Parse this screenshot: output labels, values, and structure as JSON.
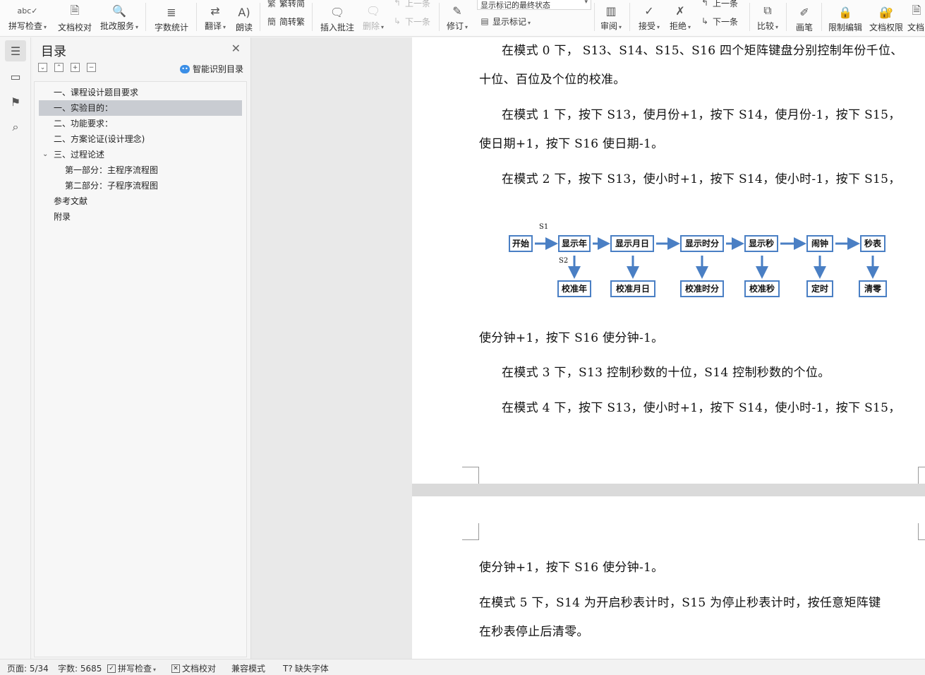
{
  "ribbon": {
    "buttons": [
      {
        "label": "拼写检查",
        "icon": "abc",
        "dropdown": true
      },
      {
        "label": "文档校对",
        "icon": "doc-check",
        "dropdown": false
      },
      {
        "label": "批改服务",
        "icon": "review-service",
        "dropdown": true
      },
      {
        "label": "字数统计",
        "icon": "word-count",
        "dropdown": false
      },
      {
        "label": "翻译",
        "icon": "translate",
        "dropdown": true
      },
      {
        "label": "朗读",
        "icon": "read-aloud",
        "dropdown": false
      },
      {
        "label": "插入批注",
        "icon": "insert-comment",
        "dropdown": false
      },
      {
        "label": "修订",
        "icon": "track-changes",
        "dropdown": true
      },
      {
        "label": "审阅",
        "icon": "review-pane",
        "dropdown": true
      },
      {
        "label": "接受",
        "icon": "accept",
        "dropdown": true
      },
      {
        "label": "拒绝",
        "icon": "reject",
        "dropdown": true
      },
      {
        "label": "比较",
        "icon": "compare",
        "dropdown": true
      },
      {
        "label": "画笔",
        "icon": "pen",
        "dropdown": false
      },
      {
        "label": "限制编辑",
        "icon": "restrict-edit",
        "dropdown": false
      },
      {
        "label": "文档权限",
        "icon": "doc-permission",
        "dropdown": false
      },
      {
        "label": "文档",
        "icon": "doc",
        "dropdown": false
      }
    ],
    "small": {
      "trad_to_simp": "繁转简",
      "simp_to_trad": "简转繁",
      "delete": "删除",
      "prev_comment": "上一条",
      "next_comment": "下一条",
      "show_markup": "显示标记",
      "prev_change": "上一条",
      "next_change": "下一条"
    },
    "markup_state": "显示标记的最终状态"
  },
  "toc": {
    "title": "目录",
    "smart_label": "智能识别目录",
    "items": [
      {
        "label": "一、课程设计题目要求",
        "level": 1,
        "selected": false
      },
      {
        "label": "一、实验目的：",
        "level": 1,
        "selected": true
      },
      {
        "label": "二、功能要求：",
        "level": 1,
        "selected": false
      },
      {
        "label": "二、方案论证(设计理念)",
        "level": 1,
        "selected": false
      },
      {
        "label": "三、过程论述",
        "level": 1,
        "selected": false,
        "expanded": true
      },
      {
        "label": "第一部分：主程序流程图",
        "level": 2,
        "selected": false
      },
      {
        "label": "第二部分：子程序流程图",
        "level": 2,
        "selected": false
      },
      {
        "label": "参考文献",
        "level": 1,
        "selected": false
      },
      {
        "label": "附录",
        "level": 1,
        "selected": false
      }
    ]
  },
  "document": {
    "page1_paragraphs": [
      "在模式 0 下， S13、S14、S15、S16 四个矩阵键盘分别控制年份千位、",
      "十位、百位及个位的校准。",
      "在模式 1 下，按下 S13，使月份+1，按下 S14，使月份-1，按下 S15，",
      "使日期+1，按下 S16 使日期-1。",
      "在模式 2 下，按下 S13，使小时+1，按下 S14，使小时-1，按下 S15，",
      "使分钟+1，按下 S16 使分钟-1。",
      "在模式 3 下，S13 控制秒数的十位，S14 控制秒数的个位。",
      "在模式 4 下，按下 S13，使小时+1，按下 S14，使小时-1，按下 S15，"
    ],
    "page2_paragraphs": [
      "使分钟+1，按下 S16 使分钟-1。",
      "在模式 5 下，S14 为开启秒表计时，S15 为停止秒表计时，按任意矩阵键",
      "在秒表停止后清零。"
    ],
    "flowchart": {
      "top_row": [
        "开始",
        "显示年",
        "显示月日",
        "显示时分",
        "显示秒",
        "闹钟",
        "秒表"
      ],
      "bottom_row": [
        "校准年",
        "校准月日",
        "校准时分",
        "校准秒",
        "定时",
        "清零"
      ],
      "label_s1": "S1",
      "label_s2": "S2"
    }
  },
  "status": {
    "page": "页面: 5/34",
    "words": "字数: 5685",
    "spell": "拼写检查",
    "proof": "文档校对",
    "compat": "兼容模式",
    "missing_font": "缺失字体"
  }
}
